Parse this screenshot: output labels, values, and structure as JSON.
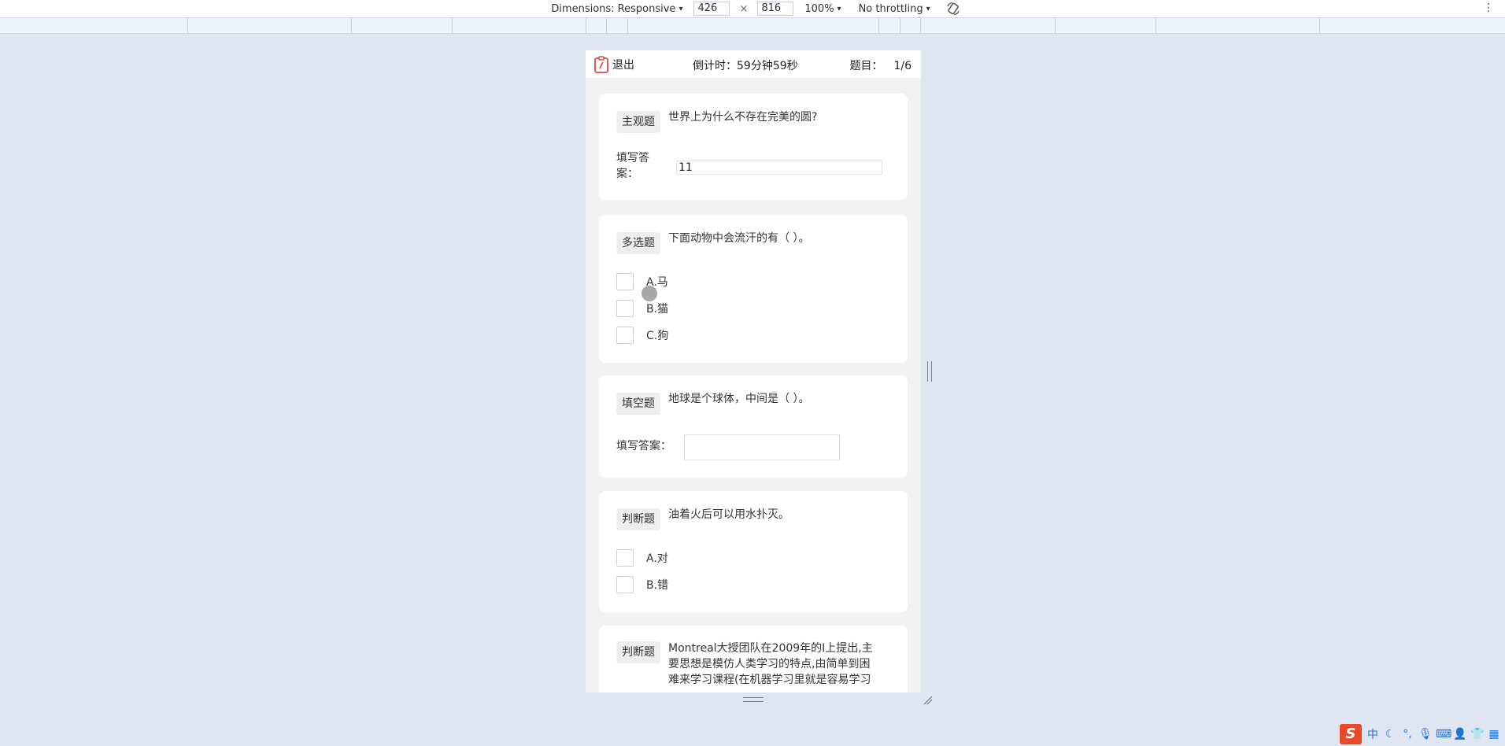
{
  "devtools": {
    "dimensions_label": "Dimensions: Responsive",
    "width": "426",
    "times": "×",
    "height": "816",
    "zoom": "100%",
    "throttling": "No throttling"
  },
  "header": {
    "exit_label": "退出",
    "timer_text": "倒计时：59分钟59秒",
    "question_label": "题目：",
    "question_value": "1/6"
  },
  "questions": [
    {
      "tag": "主观题",
      "text": "世界上为什么不存在完美的圆?",
      "answer_label": "填写答案：",
      "answer_value": "11"
    },
    {
      "tag": "多选题",
      "text": "下面动物中会流汗的有（ ）。",
      "options": [
        "A.马",
        "B.猫",
        "C.狗"
      ]
    },
    {
      "tag": "填空题",
      "text": "地球是个球体，中间是（ ）。",
      "answer_label": "填写答案：",
      "answer_value": ""
    },
    {
      "tag": "判断题",
      "text": "油着火后可以用水扑灭。",
      "options": [
        "A.对",
        "B.错"
      ]
    },
    {
      "tag": "判断题",
      "text_lines": [
        "Montreal大授团队在2009年的I上提出,主",
        "要思想是模仿人类学习的特点,由简单到困",
        "难来学习课程(在机器学习里就是容易学习"
      ]
    }
  ],
  "tray": {
    "logo": "S",
    "ime_mode": "中"
  },
  "colors": {
    "page_bg": "#dfe6f2",
    "viewport_bg": "#f2f2f2",
    "exit_icon": "#e04a4a",
    "ime_logo": "#e84a2a"
  }
}
